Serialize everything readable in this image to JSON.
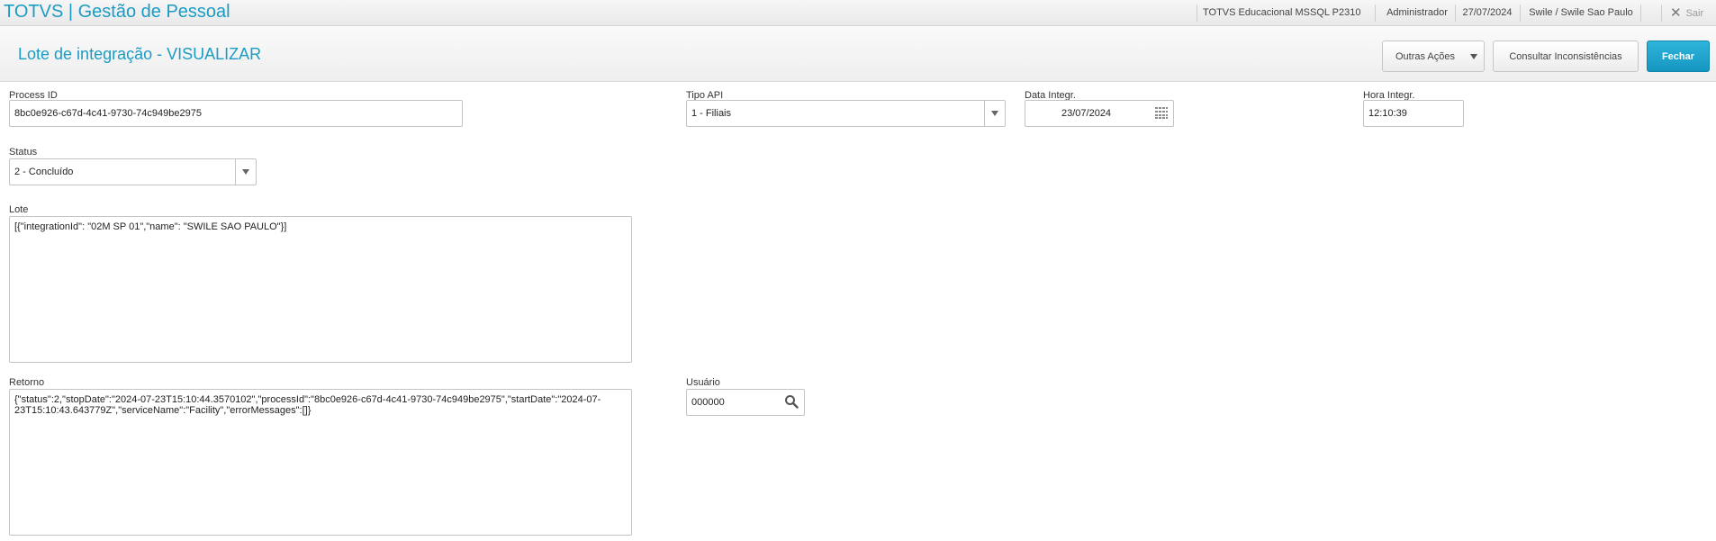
{
  "app": {
    "title": "TOTVS | Gestão de Pessoal"
  },
  "topbar": {
    "environment": "TOTVS Educacional MSSQL P2310",
    "user": "Administrador",
    "date": "27/07/2024",
    "company": "Swile / Swile Sao Paulo",
    "exit_label": "Sair"
  },
  "header": {
    "page_title": "Lote de integração - VISUALIZAR",
    "actions": {
      "other_actions": "Outras Ações",
      "check_issues": "Consultar Inconsistências",
      "close": "Fechar"
    }
  },
  "form": {
    "process_id": {
      "label": "Process ID",
      "value": "8bc0e926-c67d-4c41-9730-74c949be2975"
    },
    "tipo_api": {
      "label": "Tipo API",
      "value": "1 - Filiais"
    },
    "data_integr": {
      "label": "Data Integr.",
      "value": "23/07/2024"
    },
    "hora_integr": {
      "label": "Hora Integr.",
      "value": "12:10:39"
    },
    "status": {
      "label": "Status",
      "value": "2 - Concluído"
    },
    "lote": {
      "label": "Lote",
      "value": "[{\"integrationId\": \"02M SP 01\",\"name\": \"SWILE SAO PAULO\"}]"
    },
    "retorno": {
      "label": "Retorno",
      "value": "{\"status\":2,\"stopDate\":\"2024-07-23T15:10:44.3570102\",\"processId\":\"8bc0e926-c67d-4c41-9730-74c949be2975\",\"startDate\":\"2024-07-23T15:10:43.643779Z\",\"serviceName\":\"Facility\",\"errorMessages\":[]}"
    },
    "usuario": {
      "label": "Usuário",
      "value": "000000"
    }
  },
  "icons": {
    "calendar": "calendar-icon",
    "search": "search-icon",
    "close": "close-icon"
  },
  "colors": {
    "accent": "#1a9cc4",
    "primary_button": "#1496c0"
  }
}
